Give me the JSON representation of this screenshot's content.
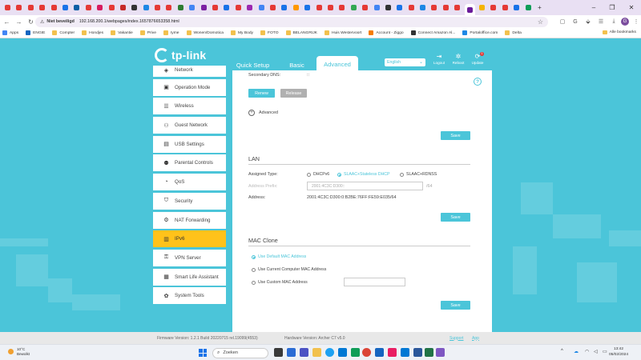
{
  "browser": {
    "tabs": [
      {
        "color": "#e53935"
      },
      {
        "color": "#e53935"
      },
      {
        "color": "#e53935"
      },
      {
        "color": "#e53935"
      },
      {
        "color": "#e53935"
      },
      {
        "color": "#1a73e8"
      },
      {
        "color": "#0b5fa5"
      },
      {
        "color": "#e53935"
      },
      {
        "color": "#d81b60"
      },
      {
        "color": "#e53935"
      },
      {
        "color": "#c62828"
      },
      {
        "color": "#333333"
      },
      {
        "color": "#1e88e5"
      },
      {
        "color": "#e53935"
      },
      {
        "color": "#e53935"
      },
      {
        "color": "#2e7d32"
      },
      {
        "color": "#4285f4"
      },
      {
        "color": "#7b1fa2"
      },
      {
        "color": "#e53935"
      },
      {
        "color": "#1a73e8"
      },
      {
        "color": "#e53935"
      },
      {
        "color": "#9c27b0"
      },
      {
        "color": "#4285f4"
      },
      {
        "color": "#e53935"
      },
      {
        "color": "#1a73e8"
      },
      {
        "color": "#ff9800"
      },
      {
        "color": "#1a73e8"
      },
      {
        "color": "#e53935"
      },
      {
        "color": "#e53935"
      },
      {
        "color": "#e53935"
      },
      {
        "color": "#34a853"
      },
      {
        "color": "#e53935"
      },
      {
        "color": "#4285f4"
      },
      {
        "color": "#333333"
      },
      {
        "color": "#1a73e8"
      },
      {
        "color": "#e53935"
      },
      {
        "color": "#1e88e5"
      },
      {
        "color": "#e53935"
      },
      {
        "color": "#e53935"
      },
      {
        "color": "#e53935"
      },
      {
        "color": "#6a1b9a"
      },
      {
        "color": "#f4b400"
      },
      {
        "color": "#e53935"
      },
      {
        "color": "#e53935"
      },
      {
        "color": "#1a73e8"
      },
      {
        "color": "#0f9d58"
      }
    ],
    "security_label": "Niet beveiligd",
    "url": "192.168.200.1/webpages/index.1657876653358.html",
    "avatar_letter": "G",
    "bookmarks": [
      {
        "label": "Apps",
        "color": "#4285f4"
      },
      {
        "label": "ENGIE",
        "color": "#1565c0"
      },
      {
        "label": "Compter",
        "color": "#f2c14e"
      },
      {
        "label": "Hondjes",
        "color": "#f2c14e"
      },
      {
        "label": "Vakantie",
        "color": "#f2c14e"
      },
      {
        "label": "Prive",
        "color": "#f2c14e"
      },
      {
        "label": "Iyme",
        "color": "#f2c14e"
      },
      {
        "label": "Wonen/Domotica",
        "color": "#f2c14e"
      },
      {
        "label": "My Body",
        "color": "#f2c14e"
      },
      {
        "label": "FOTO",
        "color": "#f2c14e"
      },
      {
        "label": "BELANGRIJK",
        "color": "#f2c14e"
      },
      {
        "label": "Huis Westervoort",
        "color": "#f2c14e"
      },
      {
        "label": "Account - Ziggo",
        "color": "#f57c00"
      },
      {
        "label": "Connect Amazon Al...",
        "color": "#333333"
      },
      {
        "label": "Portaloffice.com",
        "color": "#1e88e5"
      },
      {
        "label": "Delta",
        "color": "#f2c14e"
      }
    ],
    "all_bookmarks": "Alle bookmarks"
  },
  "router": {
    "logo_text": "tp-link",
    "tabs": [
      "Quick Setup",
      "Basic",
      "Advanced"
    ],
    "language": "English",
    "header_icons": [
      {
        "label": "Logout",
        "icon": "logout-icon",
        "glyph": "⇥"
      },
      {
        "label": "Reboot",
        "icon": "reboot-icon",
        "glyph": "✲"
      },
      {
        "label": "Update",
        "icon": "update-icon",
        "glyph": "⟳",
        "badge": "1"
      }
    ],
    "sidebar": [
      {
        "label": "Network",
        "icon": "network-icon",
        "glyph": "◈"
      },
      {
        "label": "Operation Mode",
        "icon": "operation-mode-icon",
        "glyph": "▣"
      },
      {
        "label": "Wireless",
        "icon": "wireless-icon",
        "glyph": "☰"
      },
      {
        "label": "Guest Network",
        "icon": "guest-network-icon",
        "glyph": "⚇"
      },
      {
        "label": "USB Settings",
        "icon": "usb-icon",
        "glyph": "▤"
      },
      {
        "label": "Parental Controls",
        "icon": "parental-controls-icon",
        "glyph": "⚉"
      },
      {
        "label": "QoS",
        "icon": "qos-icon",
        "glyph": "◔"
      },
      {
        "label": "Security",
        "icon": "security-icon",
        "glyph": "⛉"
      },
      {
        "label": "NAT Forwarding",
        "icon": "nat-forwarding-icon",
        "glyph": "⚙"
      },
      {
        "label": "IPv6",
        "icon": "ipv6-icon",
        "glyph": "▥",
        "active": true
      },
      {
        "label": "VPN Server",
        "icon": "vpn-icon",
        "glyph": "⚿"
      },
      {
        "label": "Smart Life Assistant",
        "icon": "smart-life-icon",
        "glyph": "▦"
      },
      {
        "label": "System Tools",
        "icon": "system-tools-icon",
        "glyph": "✿"
      }
    ],
    "content": {
      "secondary_dns_label": "Secondary DNS:",
      "secondary_dns_value": "::",
      "renew": "Renew",
      "release": "Release",
      "advanced": "Advanced",
      "save": "Save",
      "lan_title": "LAN",
      "assigned_type_label": "Assigned Type:",
      "assigned_types": [
        "DHCPv6",
        "SLAAC+Stateless DHCP",
        "SLAAC+RDNSS"
      ],
      "assigned_type_selected": "SLAAC+Stateless DHCP",
      "address_prefix_label": "Address Prefix:",
      "address_prefix_value": "2001:4C3C:D300::",
      "prefix_suffix": "/64",
      "address_label": "Address:",
      "address_value": "2001:4C3C:D300:0:B2BE:76FF:FE59:E035/64",
      "mac_clone_title": "MAC Clone",
      "mac_options": [
        "Use Default MAC Address",
        "Use Current Computer MAC Address",
        "Use Custom MAC Address"
      ],
      "mac_selected": "Use Default MAC Address"
    },
    "footer": {
      "firmware": "Firmware Version: 1.2.1 Build 20220715 rel.19099(4553)",
      "hardware": "Hardware Version: Archer C7 v5.0",
      "support": "Support",
      "app": "App"
    }
  },
  "taskbar": {
    "temp": "10°C",
    "weather": "Bewolkt",
    "search": "Zoeken",
    "time": "13:42",
    "date": "05/02/2024"
  }
}
